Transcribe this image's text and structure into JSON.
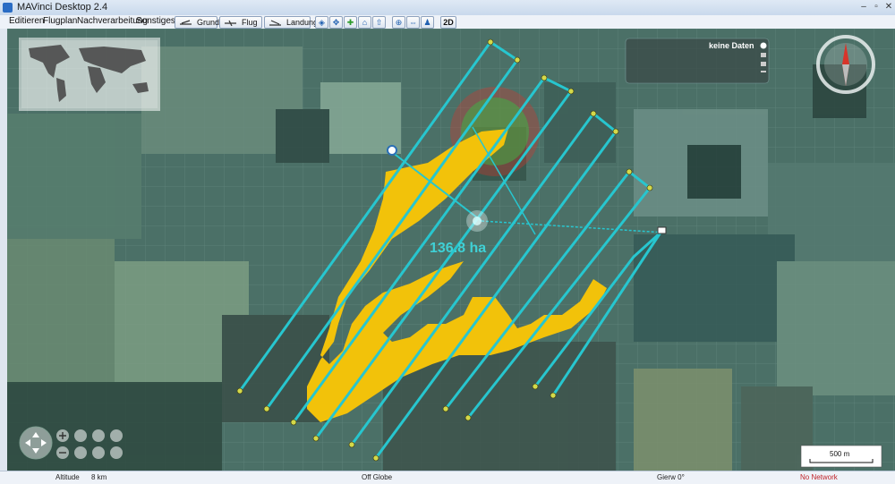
{
  "window": {
    "title": "MAVinci Desktop 2.4",
    "buttons": [
      "–",
      "▫",
      "✕"
    ]
  },
  "menu": {
    "items": [
      "Editieren",
      "Flugplan",
      "Nachverarbeitung",
      "Sonstiges"
    ]
  },
  "toolbar": {
    "grund_label": "Grund",
    "flug_label": "Flug",
    "landung_label": "Landung",
    "view_2d_label": "2D"
  },
  "map": {
    "area_label": "136.8 ha",
    "info_panel_text": "keine Daten",
    "scale_label": "500 m",
    "colors": {
      "area": "#f2c20a",
      "flightpath": "#27c6cf",
      "zone_red": "#d8342a",
      "zone_green": "#3fae45"
    }
  },
  "status": {
    "altitude_label": "Altitude",
    "altitude_value": "8 km",
    "globe_state": "Off Globe",
    "heading": "Gierw 0°",
    "network": "No Network"
  }
}
